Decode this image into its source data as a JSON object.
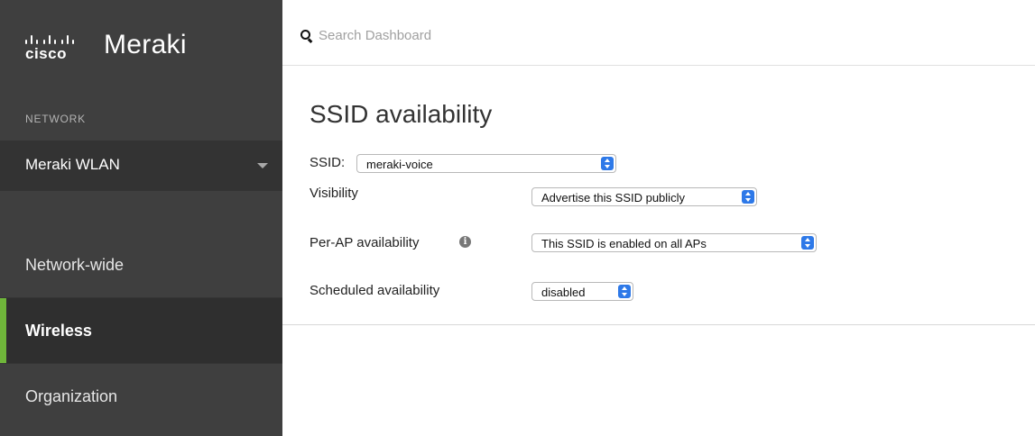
{
  "brand": {
    "cisco_text": "cisco",
    "product_name": "Meraki"
  },
  "sidebar": {
    "section_label": "NETWORK",
    "network_selector": {
      "label": "Meraki WLAN"
    },
    "items": [
      {
        "label": "Network-wide",
        "active": false
      },
      {
        "label": "Wireless",
        "active": true
      },
      {
        "label": "Organization",
        "active": false
      }
    ],
    "accent_color": "#6fb63a",
    "background_color": "#3f3f3f"
  },
  "search": {
    "placeholder": "Search Dashboard",
    "value": ""
  },
  "main": {
    "title": "SSID availability",
    "ssid": {
      "label": "SSID:",
      "value": "meraki-voice"
    },
    "fields": [
      {
        "label": "Visibility",
        "value": "Advertise this SSID publicly",
        "info": false
      },
      {
        "label": "Per-AP availability",
        "value": "This SSID is enabled on all APs",
        "info": true
      },
      {
        "label": "Scheduled availability",
        "value": "disabled",
        "info": false
      }
    ]
  },
  "icons": {
    "search": "search-icon",
    "info": "info-icon",
    "dropdown": "chevron-down-icon",
    "select_stepper": "up-down-stepper-icon"
  },
  "colors": {
    "stepper_blue": "#2e79e8"
  }
}
